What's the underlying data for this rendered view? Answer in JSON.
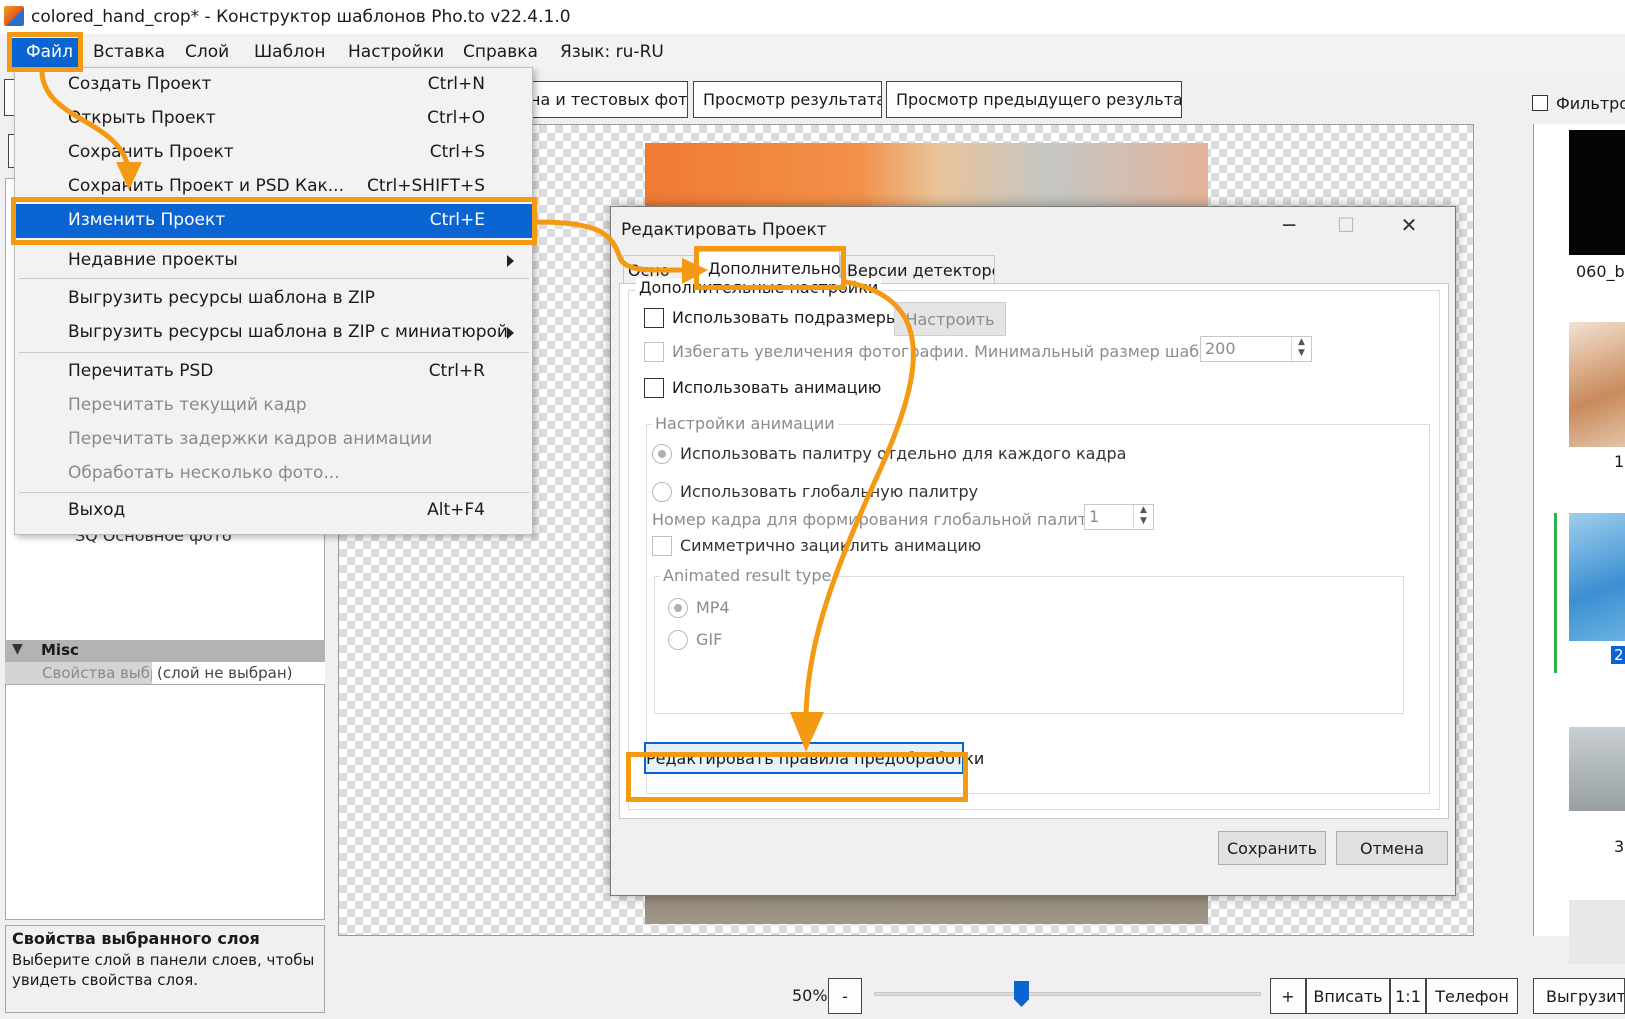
{
  "window": {
    "title": "colored_hand_crop* - Конструктор шаблонов Pho.to v22.4.1.0"
  },
  "menubar": {
    "items": [
      "Файл",
      "Вставка",
      "Слой",
      "Шаблон",
      "Настройки",
      "Справка",
      "Язык: ru-RU"
    ]
  },
  "toolbar": {
    "tab_photo_partial": "на и тестовых фото",
    "preview_label": "Просмотр результата",
    "prev_preview_label": "Просмотр предыдущего результата",
    "filter_label_partial": "Фильтро"
  },
  "left_panel": {
    "partial_layer_text": "SQ Основное фото",
    "misc_header": "Misc",
    "misc_prop_name": "Свойства выбр",
    "misc_prop_value": "(слой не выбран)",
    "props_title": "Свойства выбранного слоя",
    "props_desc_line1": "Выберите слой в панели слоев, чтобы",
    "props_desc_line2": "увидеть свойства слоя."
  },
  "thumbnails": {
    "label_1": "060_b",
    "label_2": "1",
    "label_3": "2",
    "label_4": "3"
  },
  "file_menu": {
    "items": [
      {
        "label": "Создать Проект",
        "shortcut": "Ctrl+N"
      },
      {
        "label": "Открыть Проект",
        "shortcut": "Ctrl+O"
      },
      {
        "label": "Сохранить Проект",
        "shortcut": "Ctrl+S"
      },
      {
        "label": "Сохранить Проект и PSD Как...",
        "shortcut": "Ctrl+SHIFT+S"
      },
      {
        "label": "Изменить Проект",
        "shortcut": "Ctrl+E"
      },
      {
        "label": "Недавние проекты",
        "shortcut": ""
      },
      {
        "label": "Выгрузить ресурсы шаблона в ZIP",
        "shortcut": ""
      },
      {
        "label": "Выгрузить ресурсы шаблона в ZIP с миниатюрой",
        "shortcut": ""
      },
      {
        "label": "Перечитать PSD",
        "shortcut": "Ctrl+R"
      },
      {
        "label": "Перечитать текущий кадр",
        "shortcut": ""
      },
      {
        "label": "Перечитать задержки кадров анимации",
        "shortcut": ""
      },
      {
        "label": "Обработать несколько фото...",
        "shortcut": ""
      },
      {
        "label": "Выход",
        "shortcut": "Alt+F4"
      }
    ]
  },
  "dialog": {
    "title": "Редактировать Проект",
    "tabs": [
      "Осно",
      "Дополнительно",
      "Версии детекторов"
    ],
    "advanced_group": "Дополнительные настройки",
    "use_subsizes": "Использовать подразмеры",
    "configure_btn": "Настроить",
    "avoid_enlarge": "Избегать увеличения фотографии. Минимальный размер шаблона:",
    "min_size_value": "200",
    "use_animation": "Использовать анимацию",
    "anim_group": "Настройки анимации",
    "palette_per_frame": "Использовать палитру отдельно для каждого кадра",
    "global_palette": "Использовать глобальную палитру",
    "global_palette_frame": "Номер кадра для формирования глобальной палитры:",
    "global_palette_frame_value": "1",
    "symmetric_loop": "Симметрично зациклить анимацию",
    "result_type_group": "Animated result type",
    "type_mp4": "MP4",
    "type_gif": "GIF",
    "edit_rules_btn": "Редактировать правила предобработки",
    "save_btn": "Сохранить",
    "cancel_btn": "Отмена"
  },
  "zoombar": {
    "zoom_value": "50%",
    "minus": "-",
    "plus": "+",
    "fit": "Вписать",
    "one_to_one": "1:1",
    "phone": "Телефон",
    "export_partial": "Выгрузить"
  },
  "colors": {
    "accent_blue": "#0a64d2",
    "annotation_orange": "#f39a12"
  }
}
